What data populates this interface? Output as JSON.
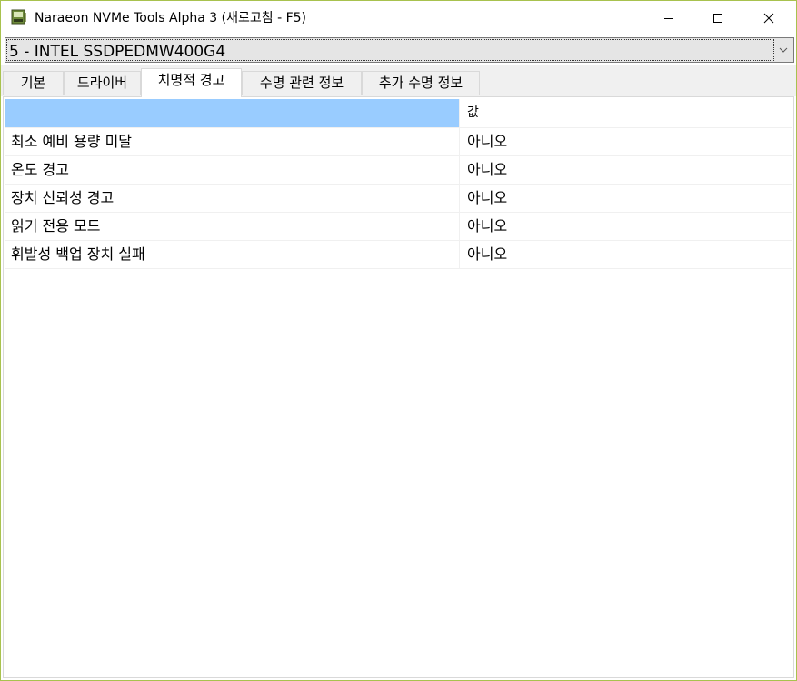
{
  "window": {
    "title": "Naraeon NVMe Tools Alpha 3 (새로고침 - F5)",
    "border_color": "#a8c24e"
  },
  "drive_selector": {
    "selected": "5 - INTEL SSDPEDMW400G4"
  },
  "tabs": [
    {
      "label": "기본",
      "active": false
    },
    {
      "label": "드라이버",
      "active": false
    },
    {
      "label": "치명적 경고",
      "active": true
    },
    {
      "label": "수명 관련 정보",
      "active": false
    },
    {
      "label": "추가 수명 정보",
      "active": false
    }
  ],
  "grid": {
    "header": {
      "name": "",
      "value": "값",
      "name_header_color": "#99ccff"
    },
    "rows": [
      {
        "name": "최소 예비 용량 미달",
        "value": "아니오"
      },
      {
        "name": "온도 경고",
        "value": "아니오"
      },
      {
        "name": "장치 신뢰성 경고",
        "value": "아니오"
      },
      {
        "name": "읽기 전용 모드",
        "value": "아니오"
      },
      {
        "name": "휘발성 백업 장치 실패",
        "value": "아니오"
      }
    ]
  },
  "icons": {
    "app": "drive-app-icon",
    "minimize": "minimize-icon",
    "maximize": "maximize-icon",
    "close": "close-icon",
    "dropdown": "chevron-down-icon"
  }
}
